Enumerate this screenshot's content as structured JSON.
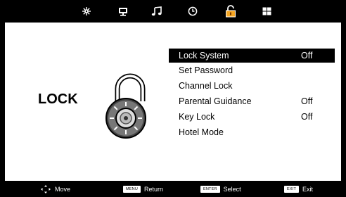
{
  "tabs": [
    {
      "icon": "picture-settings-icon"
    },
    {
      "icon": "screen-icon"
    },
    {
      "icon": "music-note-icon"
    },
    {
      "icon": "clock-icon"
    },
    {
      "icon": "lock-icon",
      "active": true
    },
    {
      "icon": "apps-grid-icon"
    }
  ],
  "page": {
    "title": "LOCK"
  },
  "menu": {
    "items": [
      {
        "label": "Lock System",
        "value": "Off",
        "selected": true
      },
      {
        "label": "Set Password",
        "value": ""
      },
      {
        "label": "Channel Lock",
        "value": ""
      },
      {
        "label": "Parental Guidance",
        "value": "Off"
      },
      {
        "label": "Key Lock",
        "value": "Off"
      },
      {
        "label": "Hotel Mode",
        "value": ""
      }
    ]
  },
  "footer": {
    "move": "Move",
    "menu_key": "MENU",
    "return": "Return",
    "enter_key": "ENTER",
    "select": "Select",
    "exit_key": "EXIT",
    "exit": "Exit"
  },
  "colors": {
    "background": "#000000",
    "panel": "#ffffff",
    "highlight": "#000000",
    "accent": "#f5a623"
  }
}
